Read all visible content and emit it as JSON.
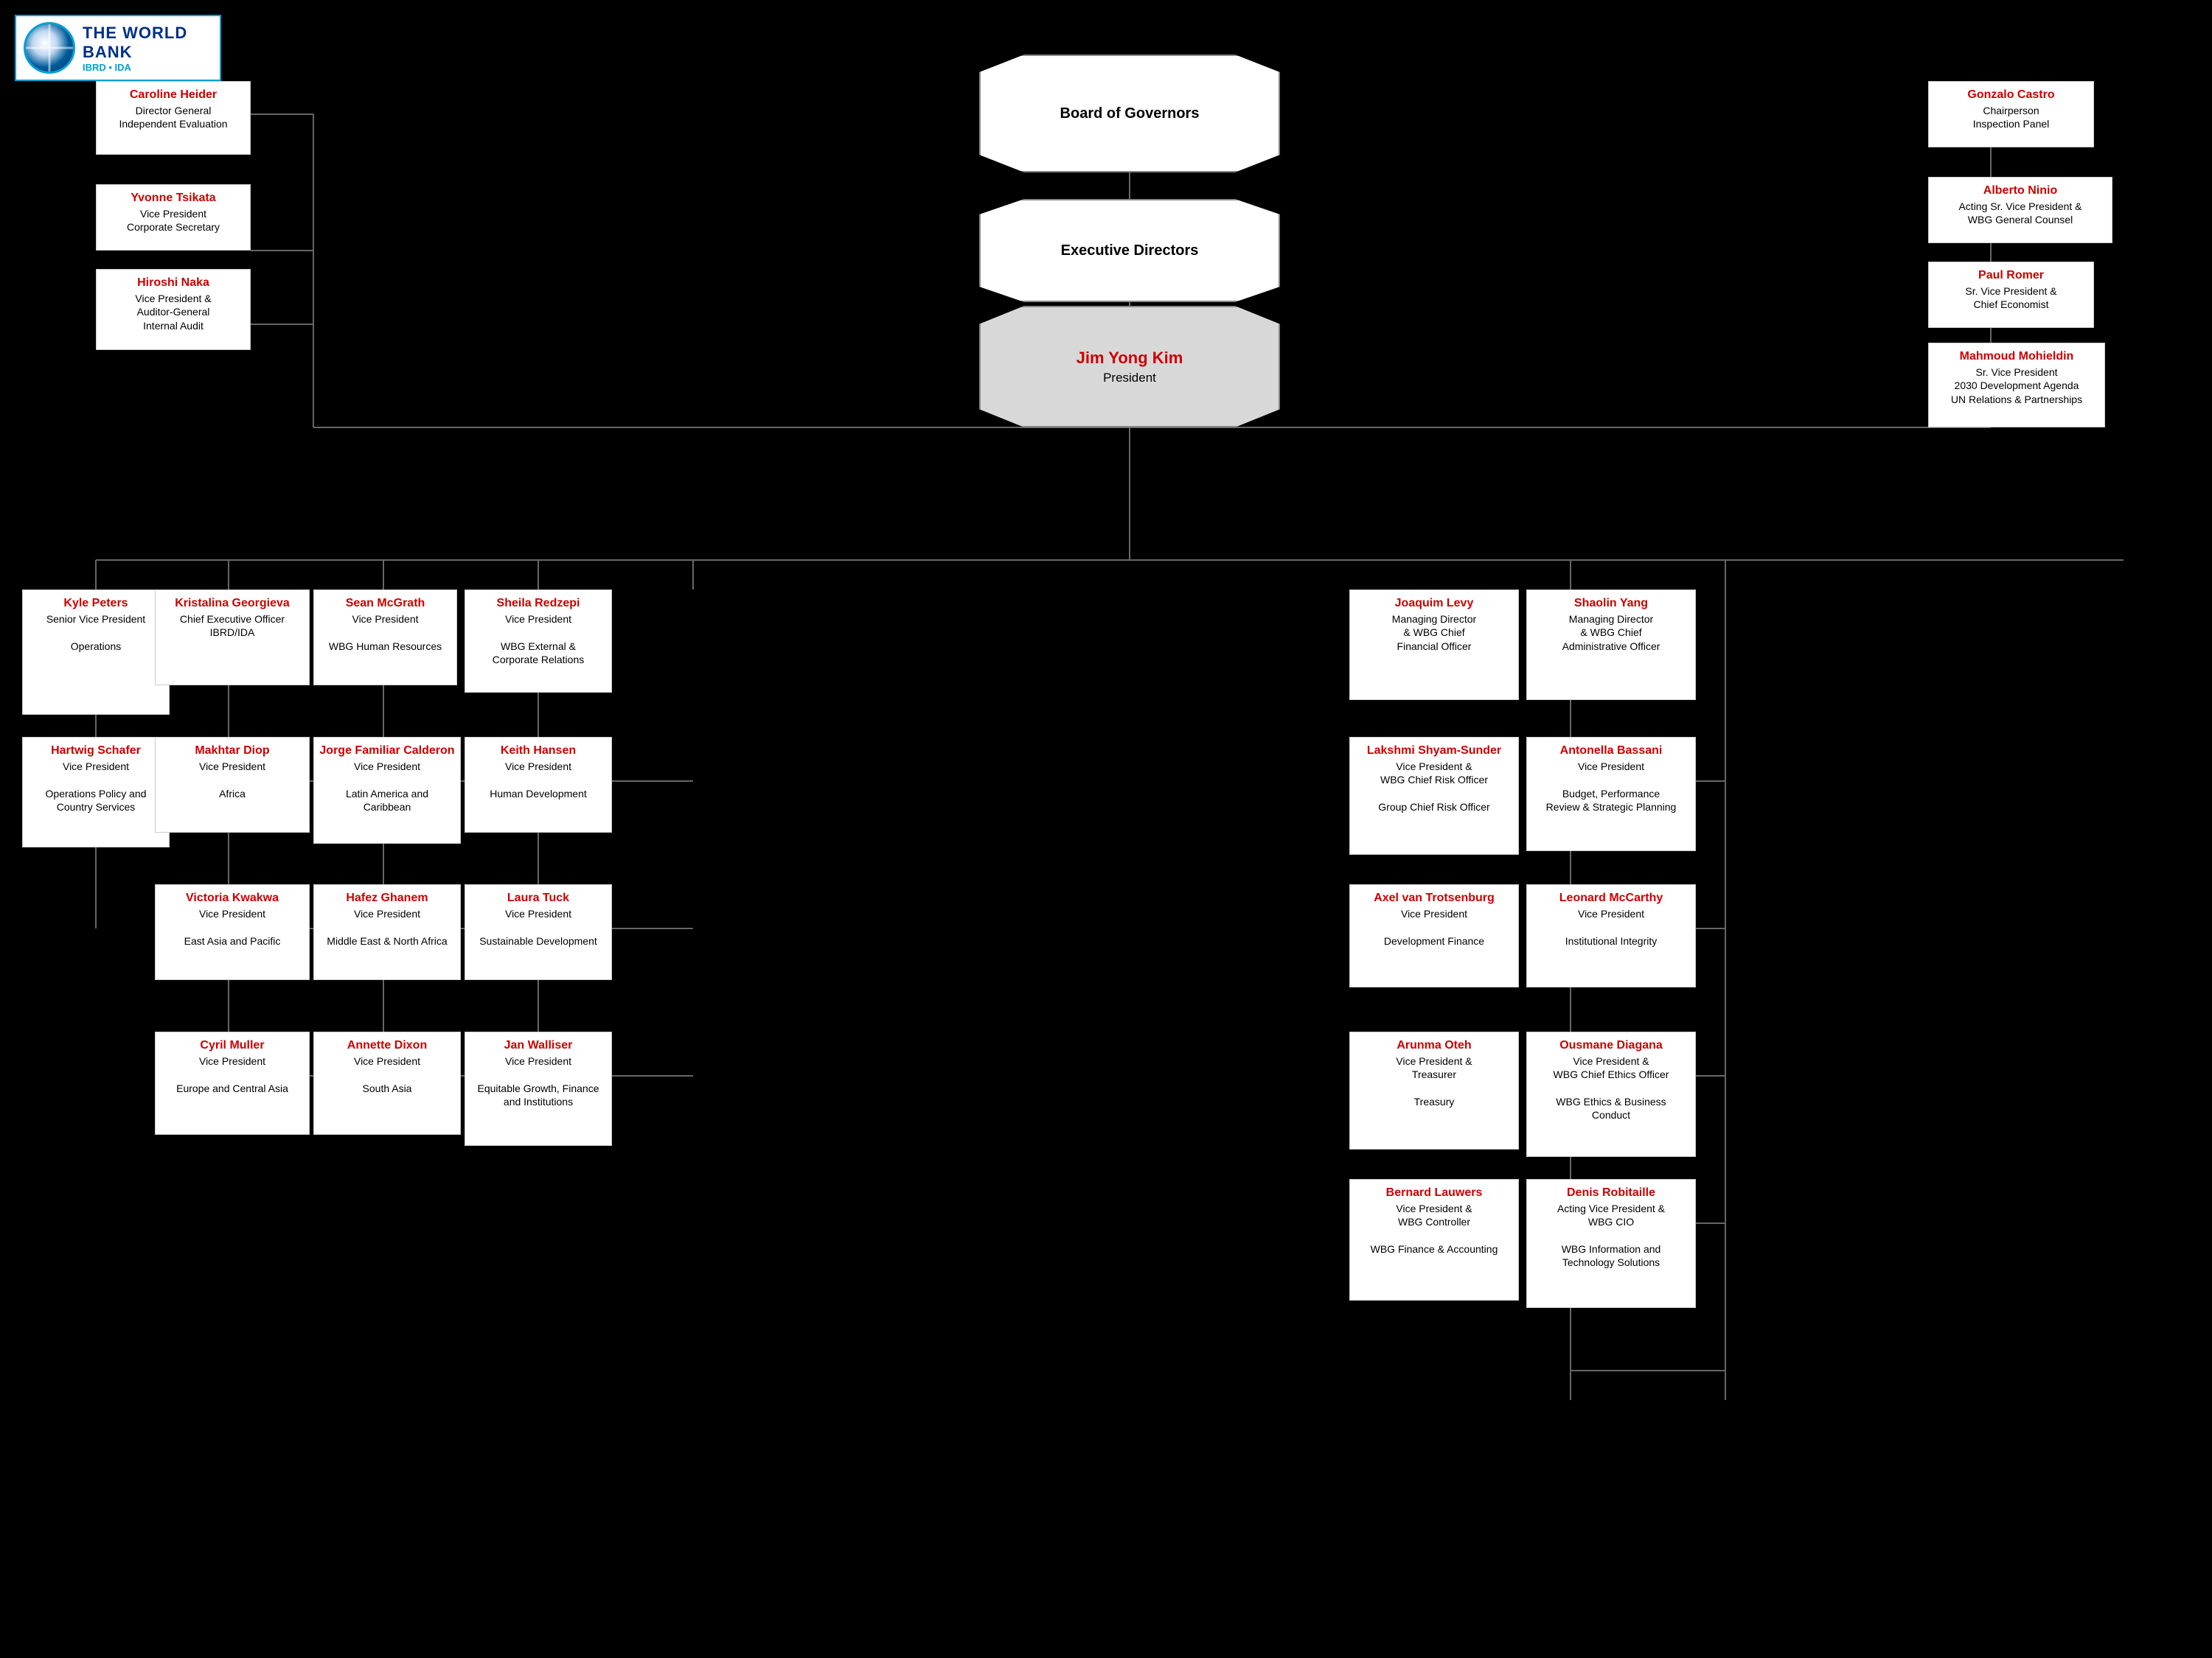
{
  "logo": {
    "main": "THE WORLD BANK",
    "sub": "IBRD • IDA"
  },
  "board_of_governors": {
    "label": "Board of Governors"
  },
  "executive_directors": {
    "label": "Executive Directors"
  },
  "president": {
    "name": "Jim Yong Kim",
    "title": "President"
  },
  "cards": {
    "caroline_heider": {
      "name": "Caroline Heider",
      "title": "Director General\nIndependent Evaluation"
    },
    "gonzalo_castro": {
      "name": "Gonzalo Castro",
      "title": "Chairperson\nInspection Panel"
    },
    "alberto_ninio": {
      "name": "Alberto Ninio",
      "title": "Acting Sr. Vice President &\nWBG General Counsel"
    },
    "paul_romer": {
      "name": "Paul Romer",
      "title": "Sr. Vice President &\nChief Economist"
    },
    "mahmoud_mohieldin": {
      "name": "Mahmoud Mohieldin",
      "title": "Sr. Vice President\n2030 Development Agenda\nUN Relations & Partnerships"
    },
    "yvonne_tsikata": {
      "name": "Yvonne Tsikata",
      "title": "Vice President\nCorporate Secretary"
    },
    "hiroshi_naka": {
      "name": "Hiroshi Naka",
      "title": "Vice President &\nAuditor-General\nInternal Audit"
    },
    "kyle_peters": {
      "name": "Kyle Peters",
      "title": "Senior Vice President\n\nOperations"
    },
    "kristalina_georgieva": {
      "name": "Kristalina Georgieva",
      "title": "Chief Executive Officer\nIBRD/IDA"
    },
    "sean_mcgrath": {
      "name": "Sean McGrath",
      "title": "Vice President\n\nWBG Human Resources"
    },
    "sheila_redzepi": {
      "name": "Sheila Redzepi",
      "title": "Vice President\n\nWBG External &\nCorporate Relations"
    },
    "joaquim_levy": {
      "name": "Joaquim Levy",
      "title": "Managing Director\n& WBG Chief\nFinancial Officer"
    },
    "shaolin_yang": {
      "name": "Shaolin Yang",
      "title": "Managing Director\n& WBG Chief\nAdministrative Officer"
    },
    "hartwig_schafer": {
      "name": "Hartwig Schafer",
      "title": "Vice President\n\nOperations Policy and\nCountry Services"
    },
    "makhtar_diop": {
      "name": "Makhtar Diop",
      "title": "Vice President\n\nAfrica"
    },
    "jorge_familiar": {
      "name": "Jorge Familiar Calderon",
      "title": "Vice President\n\nLatin America and\nCaribbean"
    },
    "keith_hansen": {
      "name": "Keith Hansen",
      "title": "Vice President\n\nHuman Development"
    },
    "lakshmi_shyam_sunder": {
      "name": "Lakshmi Shyam-Sunder",
      "title": "Vice President &\nWBG Chief Risk Officer\n\nGroup Chief Risk Officer"
    },
    "antonella_bassani": {
      "name": "Antonella Bassani",
      "title": "Vice President\n\nBudget, Performance\nReview & Strategic Planning"
    },
    "victoria_kwakwa": {
      "name": "Victoria Kwakwa",
      "title": "Vice President\n\nEast Asia and Pacific"
    },
    "hafez_ghanem": {
      "name": "Hafez Ghanem",
      "title": "Vice President\n\nMiddle East & North Africa"
    },
    "laura_tuck": {
      "name": "Laura Tuck",
      "title": "Vice President\n\nSustainable Development"
    },
    "axel_van_trotsenburg": {
      "name": "Axel van Trotsenburg",
      "title": "Vice President\n\nDevelopment Finance"
    },
    "leonard_mccarthy": {
      "name": "Leonard McCarthy",
      "title": "Vice President\n\nInstitutional Integrity"
    },
    "cyril_muller": {
      "name": "Cyril Muller",
      "title": "Vice President\n\nEurope and Central Asia"
    },
    "annette_dixon": {
      "name": "Annette Dixon",
      "title": "Vice President\n\nSouth Asia"
    },
    "jan_walliser": {
      "name": "Jan Walliser",
      "title": "Vice President\n\nEquitable Growth, Finance\nand Institutions"
    },
    "arunma_oteh": {
      "name": "Arunma Oteh",
      "title": "Vice President &\nTreasurer\n\nTreasury"
    },
    "ousmane_diagana": {
      "name": "Ousmane Diagana",
      "title": "Vice President &\nWBG Chief Ethics Officer\n\nWBG Ethics & Business\nConduct"
    },
    "bernard_lauwers": {
      "name": "Bernard Lauwers",
      "title": "Vice President &\nWBG Controller\n\nWBG Finance & Accounting"
    },
    "denis_robitaille": {
      "name": "Denis Robitaille",
      "title": "Acting Vice President &\nWBG CIO\n\nWBG Information and\nTechnology Solutions"
    }
  }
}
